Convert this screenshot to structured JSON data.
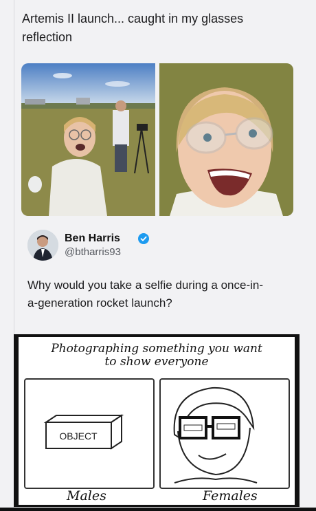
{
  "post": {
    "text_line1": "Artemis II launch... caught in my glasses",
    "text_line2": "reflection"
  },
  "quote": {
    "author_name": "Ben Harris",
    "handle": "@btharris93",
    "text_line1": "Why would you take a selfie during a once-in-",
    "text_line2": "a-generation rocket launch?"
  },
  "meme": {
    "title_line1": "Photographing something you want",
    "title_line2": "to show everyone",
    "object_label": "OBJECT",
    "left_label": "Males",
    "right_label": "Females"
  },
  "icons": {
    "verified": "verified-badge-icon"
  },
  "colors": {
    "verified_blue": "#1d9bf0"
  }
}
